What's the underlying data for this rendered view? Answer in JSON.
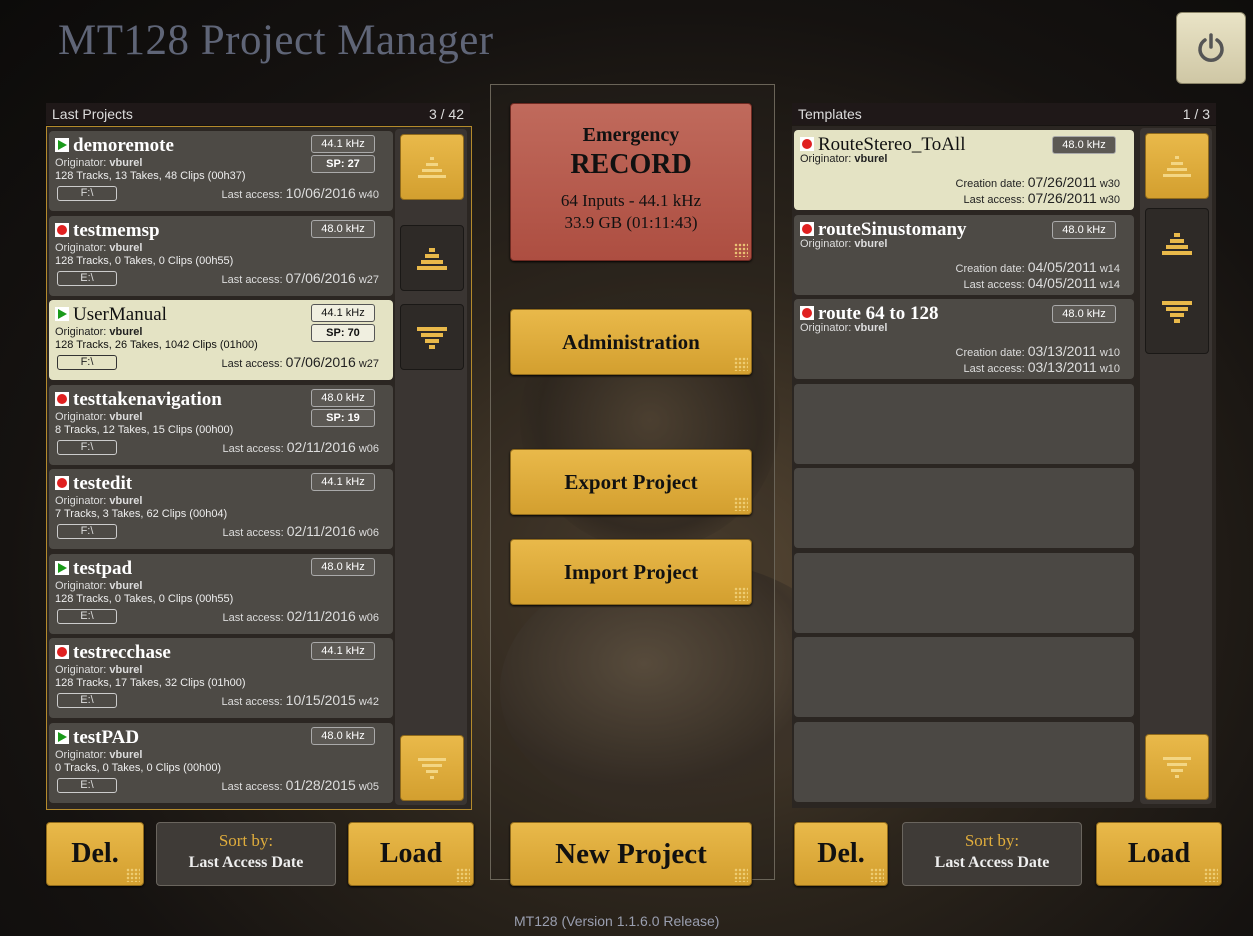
{
  "app_title": "MT128 Project Manager",
  "version": "MT128 (Version 1.1.6.0 Release)",
  "left_panel": {
    "header": "Last Projects",
    "count": "3 / 42",
    "projects": [
      {
        "name": "demoremote",
        "icon": "play-icon",
        "originator_label": "Originator:",
        "originator": "vburel",
        "meta": "128 Tracks, 13 Takes, 48 Clips (00h37)",
        "rate": "44.1 kHz",
        "sp": "SP: 27",
        "drive": "F:\\",
        "access_label": "Last access:",
        "access_date": "10/06/2016",
        "week": "w40"
      },
      {
        "name": "testmemsp",
        "icon": "record-icon",
        "originator_label": "Originator:",
        "originator": "vburel",
        "meta": "128 Tracks, 0 Takes, 0 Clips (00h55)",
        "rate": "48.0 kHz",
        "sp": "",
        "drive": "E:\\",
        "access_label": "Last access:",
        "access_date": "07/06/2016",
        "week": "w27"
      },
      {
        "name": "UserManual",
        "icon": "play-icon",
        "originator_label": "Originator:",
        "originator": "vburel",
        "meta": "128 Tracks, 26 Takes, 1042 Clips (01h00)",
        "rate": "44.1 kHz",
        "sp": "SP: 70",
        "drive": "F:\\",
        "access_label": "Last access:",
        "access_date": "07/06/2016",
        "week": "w27"
      },
      {
        "name": "testtakenavigation",
        "icon": "record-icon",
        "originator_label": "Originator:",
        "originator": "vburel",
        "meta": "8 Tracks, 12 Takes, 15 Clips (00h00)",
        "rate": "48.0 kHz",
        "sp": "SP: 19",
        "drive": "F:\\",
        "access_label": "Last access:",
        "access_date": "02/11/2016",
        "week": "w06"
      },
      {
        "name": "testedit",
        "icon": "record-icon",
        "originator_label": "Originator:",
        "originator": "vburel",
        "meta": "7 Tracks, 3 Takes, 62 Clips (00h04)",
        "rate": "44.1 kHz",
        "sp": "",
        "drive": "F:\\",
        "access_label": "Last access:",
        "access_date": "02/11/2016",
        "week": "w06"
      },
      {
        "name": "testpad",
        "icon": "play-icon",
        "originator_label": "Originator:",
        "originator": "vburel",
        "meta": "128 Tracks, 0 Takes, 0 Clips (00h55)",
        "rate": "48.0 kHz",
        "sp": "",
        "drive": "E:\\",
        "access_label": "Last access:",
        "access_date": "02/11/2016",
        "week": "w06"
      },
      {
        "name": "testrecchase",
        "icon": "record-icon",
        "originator_label": "Originator:",
        "originator": "vburel",
        "meta": "128 Tracks, 17 Takes, 32 Clips (01h00)",
        "rate": "44.1 kHz",
        "sp": "",
        "drive": "E:\\",
        "access_label": "Last access:",
        "access_date": "10/15/2015",
        "week": "w42"
      },
      {
        "name": "testPAD",
        "icon": "play-icon",
        "originator_label": "Originator:",
        "originator": "vburel",
        "meta": "0 Tracks, 0 Takes, 0 Clips (00h00)",
        "rate": "48.0 kHz",
        "sp": "",
        "drive": "E:\\",
        "access_label": "Last access:",
        "access_date": "01/28/2015",
        "week": "w05"
      }
    ],
    "del_label": "Del.",
    "sort_label": "Sort by:",
    "sort_value": "Last Access Date",
    "load_label": "Load"
  },
  "center": {
    "emergency_title": "Emergency",
    "emergency_record": "RECORD",
    "emergency_inputs": "64 Inputs - 44.1 kHz",
    "emergency_space": "33.9 GB (01:11:43)",
    "administration": "Administration",
    "export": "Export Project",
    "import": "Import Project",
    "new_project": "New Project"
  },
  "right_panel": {
    "header": "Templates",
    "count": "1 / 3",
    "templates": [
      {
        "name": "RouteStereo_ToAll",
        "icon": "record-icon",
        "originator_label": "Originator:",
        "originator": "vburel",
        "rate": "48.0 kHz",
        "creation_label": "Creation date:",
        "creation_date": "07/26/2011",
        "creation_week": "w30",
        "access_label": "Last access:",
        "access_date": "07/26/2011",
        "access_week": "w30"
      },
      {
        "name": "routeSinustomany",
        "icon": "record-icon",
        "originator_label": "Originator:",
        "originator": "vburel",
        "rate": "48.0 kHz",
        "creation_label": "Creation date:",
        "creation_date": "04/05/2011",
        "creation_week": "w14",
        "access_label": "Last access:",
        "access_date": "04/05/2011",
        "access_week": "w14"
      },
      {
        "name": "route 64 to 128",
        "icon": "record-icon",
        "originator_label": "Originator:",
        "originator": "vburel",
        "rate": "48.0 kHz",
        "creation_label": "Creation date:",
        "creation_date": "03/13/2011",
        "creation_week": "w10",
        "access_label": "Last access:",
        "access_date": "03/13/2011",
        "access_week": "w10"
      }
    ],
    "del_label": "Del.",
    "sort_label": "Sort by:",
    "sort_value": "Last Access Date",
    "load_label": "Load"
  },
  "colors": {
    "accent_gold": "#e0ad3c",
    "emergency_red": "#b5584b",
    "selected_row": "#e4e3c4",
    "row_bg": "#4d4a45"
  }
}
